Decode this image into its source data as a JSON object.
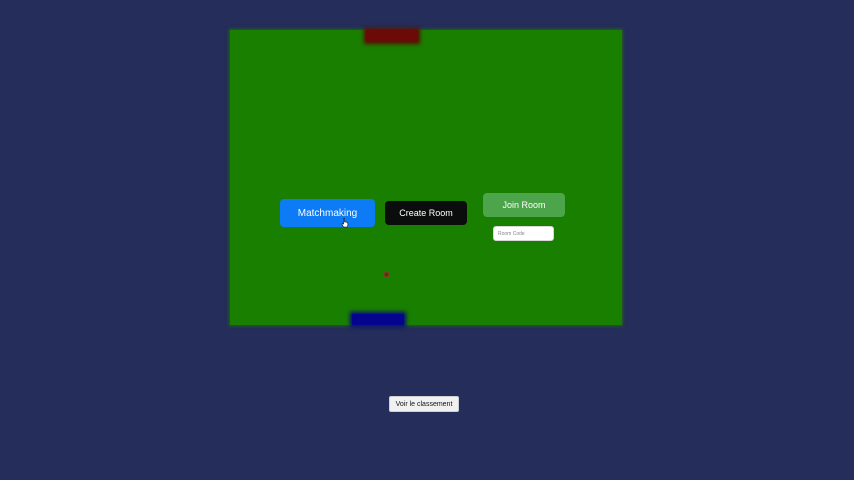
{
  "game": {
    "buttons": {
      "matchmaking": "Matchmaking",
      "create_room": "Create Room",
      "join_room": "Join Room"
    },
    "room_code": {
      "placeholder": "Room Code",
      "value": ""
    },
    "colors": {
      "background": "#252d5a",
      "field": "#197f00",
      "top_paddle": "#6b0a07",
      "bottom_paddle": "#04048f",
      "matchmaking_button": "#0d7bf5",
      "create_button": "#0b0c0c",
      "join_button": "#4ca54a"
    }
  },
  "footer": {
    "ranking_button": "Voir le classement"
  },
  "icons": {
    "cursor": "hand-pointer-icon",
    "ball": "ball-icon"
  }
}
